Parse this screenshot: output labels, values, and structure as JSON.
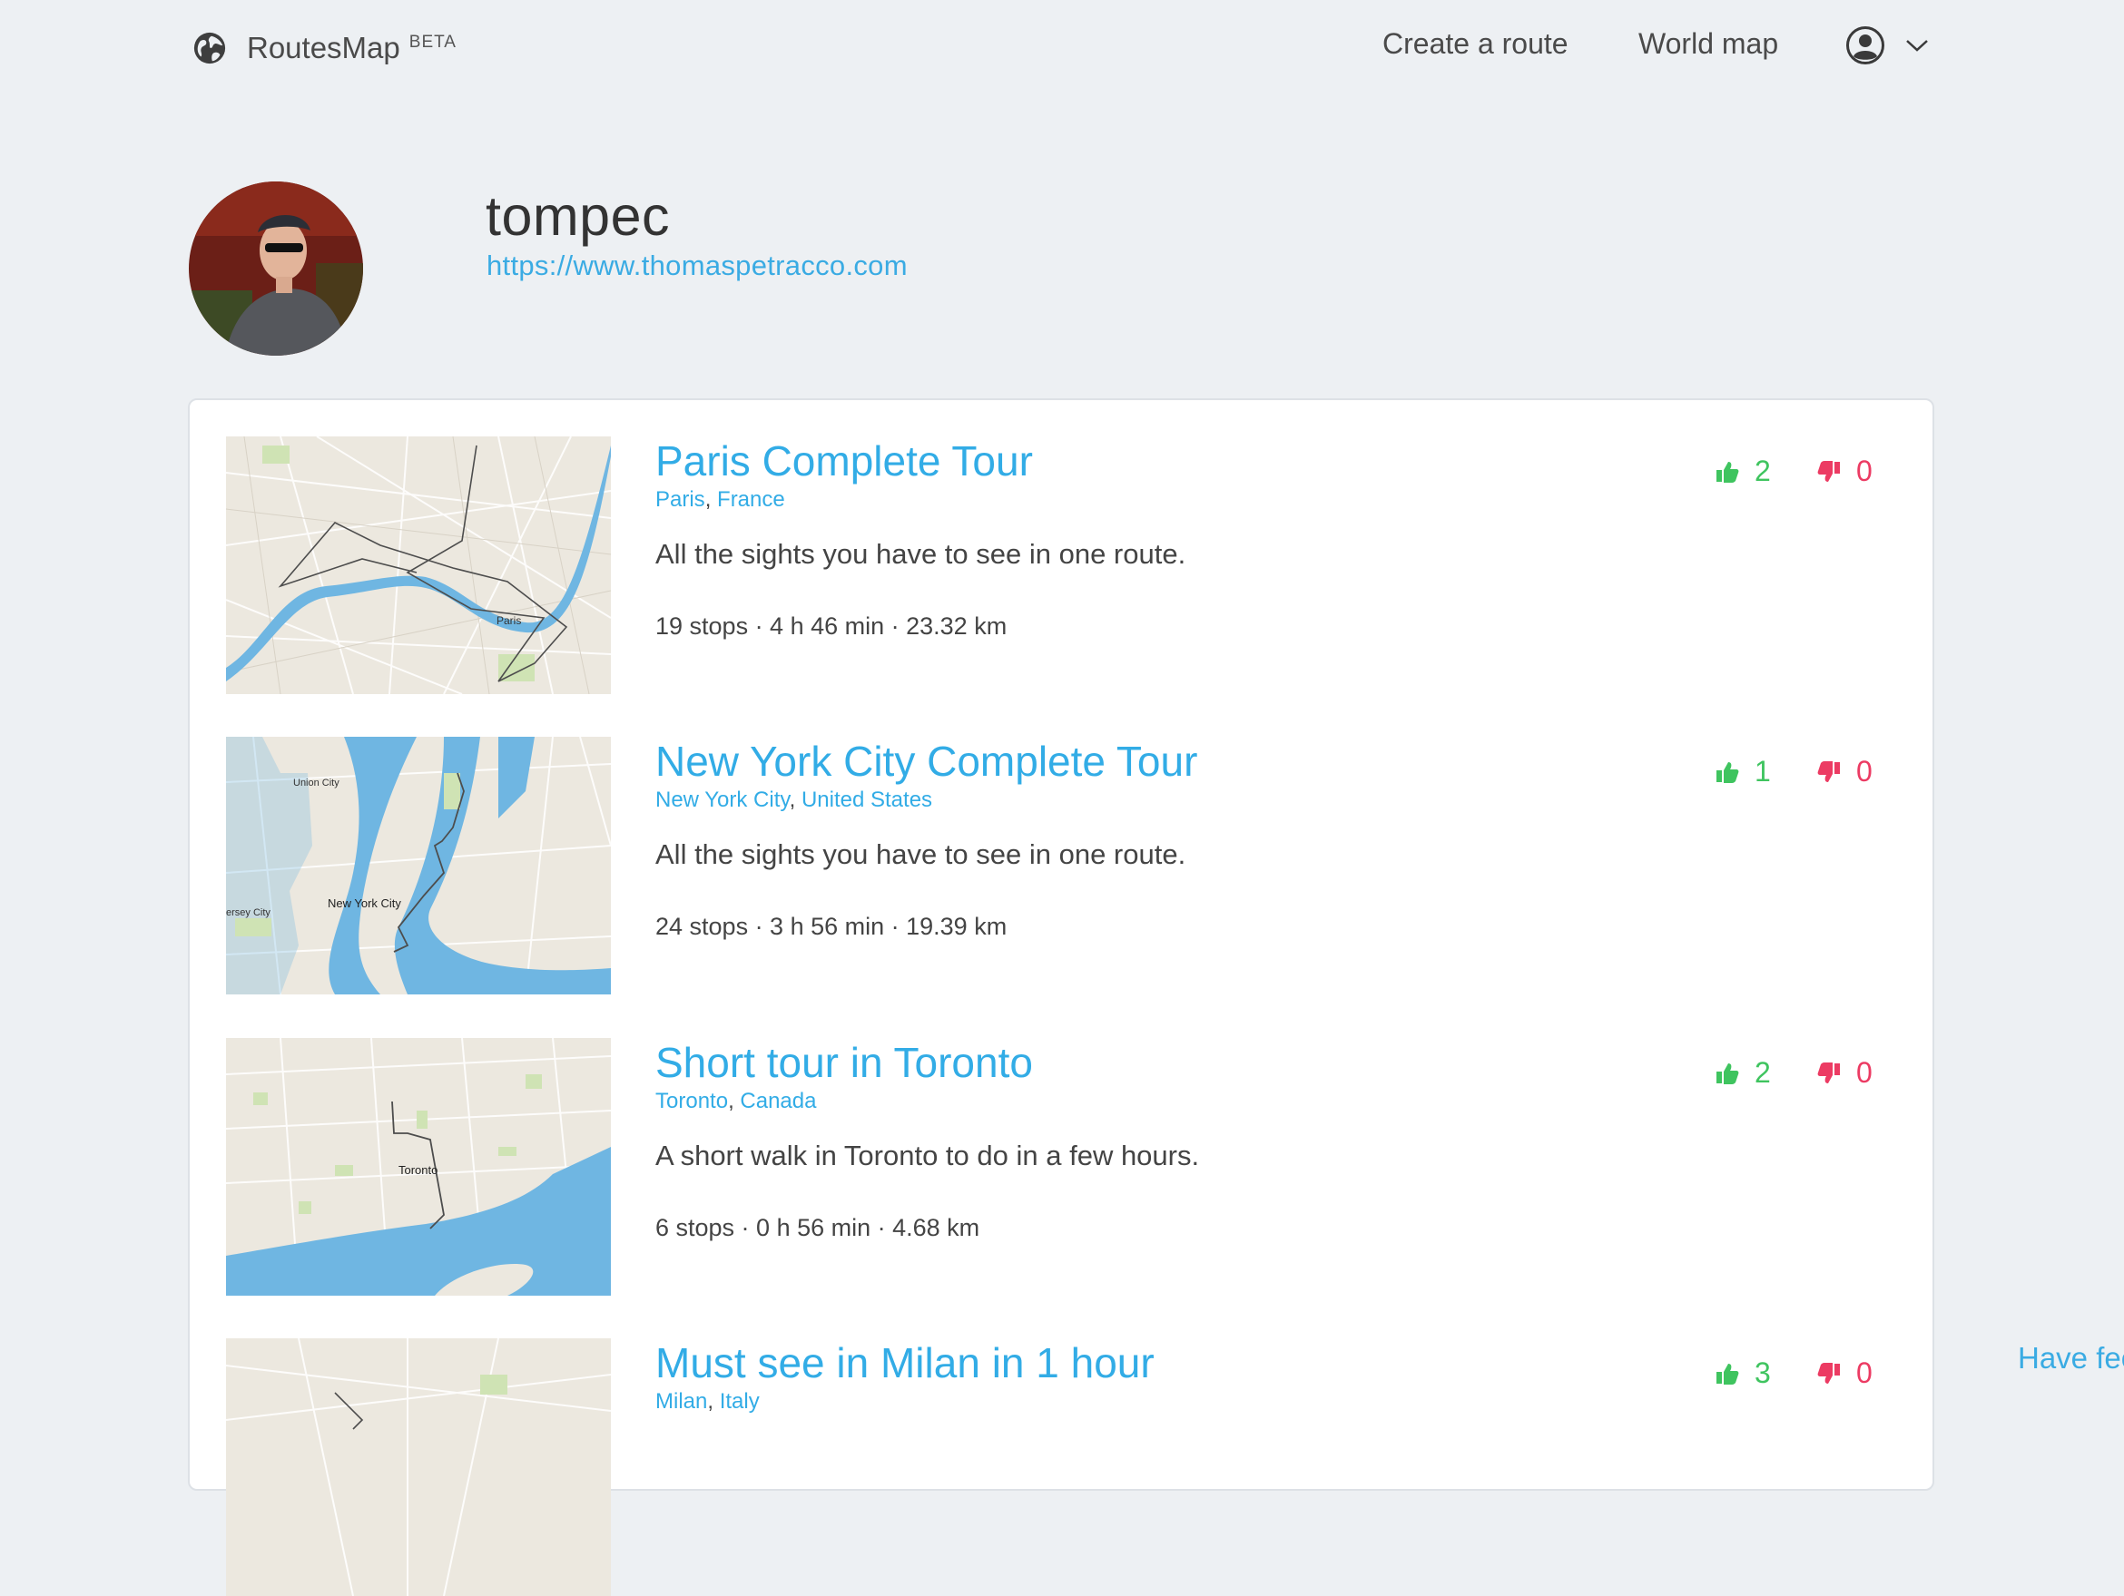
{
  "header": {
    "brand": "RoutesMap",
    "beta": "BETA",
    "nav": {
      "create": "Create a route",
      "world": "World map"
    }
  },
  "profile": {
    "username": "tompec",
    "website": "https://www.thomaspetracco.com"
  },
  "routes": [
    {
      "title": "Paris Complete Tour",
      "city": "Paris",
      "country": "France",
      "description": "All the sights you have to see in one route.",
      "stats": "19 stops · 4 h 46 min · 23.32 km",
      "likes": "2",
      "dislikes": "0",
      "map_label": "Paris"
    },
    {
      "title": "New York City Complete Tour",
      "city": "New York City",
      "country": "United States",
      "description": "All the sights you have to see in one route.",
      "stats": "24 stops · 3 h 56 min · 19.39 km",
      "likes": "1",
      "dislikes": "0",
      "map_label": "New York City",
      "map_label_2": "Union City",
      "map_label_3": "ersey City"
    },
    {
      "title": "Short tour in Toronto",
      "city": "Toronto",
      "country": "Canada",
      "description": "A short walk in Toronto to do in a few hours.",
      "stats": "6 stops · 0 h 56 min · 4.68 km",
      "likes": "2",
      "dislikes": "0",
      "map_label": "Toronto"
    },
    {
      "title": "Must see in Milan in 1 hour",
      "city": "Milan",
      "country": "Italy",
      "likes": "3",
      "dislikes": "0"
    }
  ],
  "feedback": "Have fee",
  "colors": {
    "link": "#32ace6",
    "like": "#3fc45f",
    "dislike": "#ec3b63",
    "background": "#edf0f3"
  },
  "icons": [
    "globe-icon",
    "user-avatar-icon",
    "chevron-down-icon",
    "thumbs-up-icon",
    "thumbs-down-icon"
  ]
}
